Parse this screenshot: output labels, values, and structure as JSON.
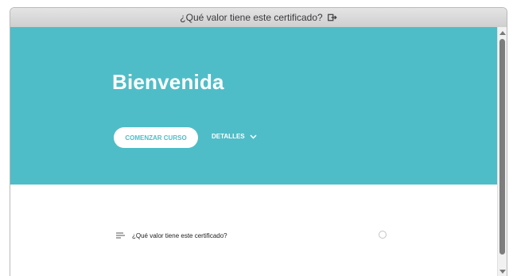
{
  "window": {
    "title": "¿Qué valor tiene este certificado?",
    "exit_icon": "exit-icon"
  },
  "hero": {
    "title": "Bienvenida",
    "start_button_label": "COMENZAR CURSO",
    "details_label": "DETALLES",
    "details_icon": "chevron-down-icon",
    "background_color": "#4fbdc8"
  },
  "lessons": [
    {
      "label": "¿Qué valor tiene este certificado?",
      "icon": "list-icon",
      "completed": false
    }
  ]
}
